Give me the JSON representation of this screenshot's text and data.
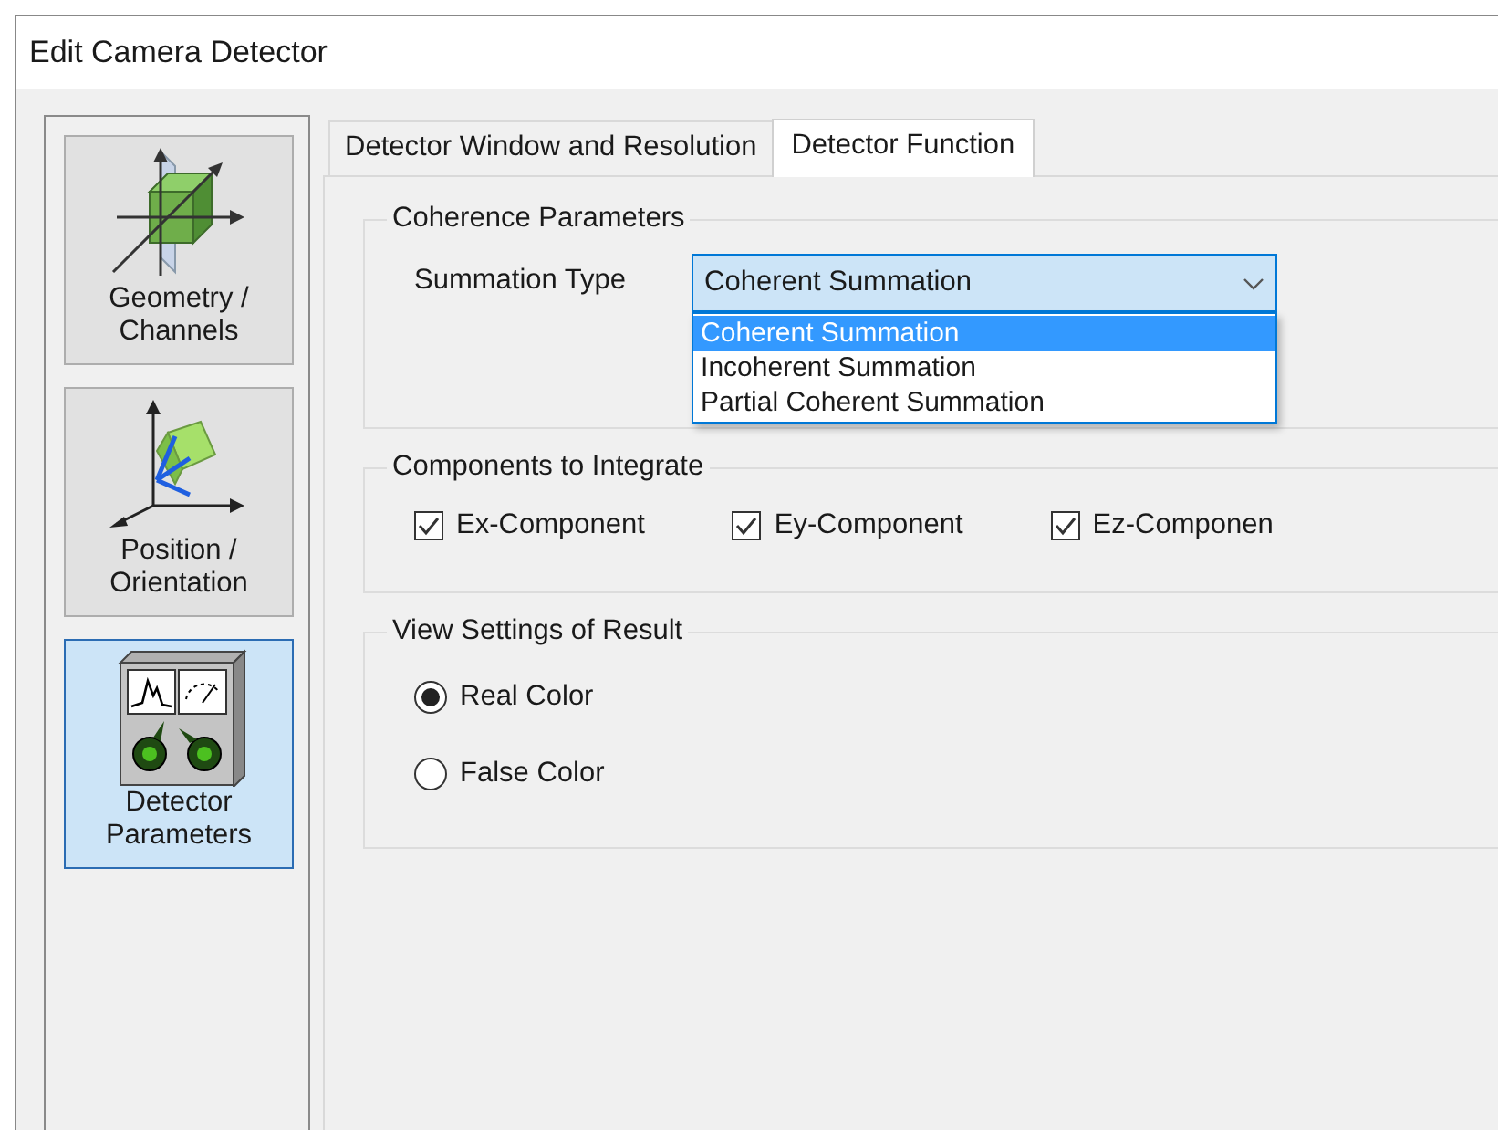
{
  "window": {
    "title": "Edit Camera Detector"
  },
  "sidebar": {
    "items": [
      {
        "label": "Geometry / Channels",
        "kind": "geometry",
        "selected": false
      },
      {
        "label": "Position / Orientation",
        "kind": "position",
        "selected": false
      },
      {
        "label": "Detector Parameters",
        "kind": "detector",
        "selected": true
      }
    ]
  },
  "tabs": [
    {
      "label": "Detector Window and Resolution",
      "selected": false
    },
    {
      "label": "Detector Function",
      "selected": true
    }
  ],
  "coherence": {
    "title": "Coherence Parameters",
    "label": "Summation Type",
    "value": "Coherent Summation",
    "expanded": true,
    "options": [
      {
        "label": "Coherent Summation",
        "selected": true
      },
      {
        "label": "Incoherent Summation",
        "selected": false
      },
      {
        "label": "Partial Coherent Summation",
        "selected": false
      }
    ]
  },
  "components": {
    "title": "Components to Integrate",
    "items": [
      {
        "label": "Ex-Component",
        "checked": true
      },
      {
        "label": "Ey-Component",
        "checked": true
      },
      {
        "label": "Ez-Componen",
        "checked": true
      }
    ]
  },
  "view": {
    "title": "View Settings of Result",
    "items": [
      {
        "label": "Real Color",
        "selected": true
      },
      {
        "label": "False Color",
        "selected": false
      }
    ]
  }
}
